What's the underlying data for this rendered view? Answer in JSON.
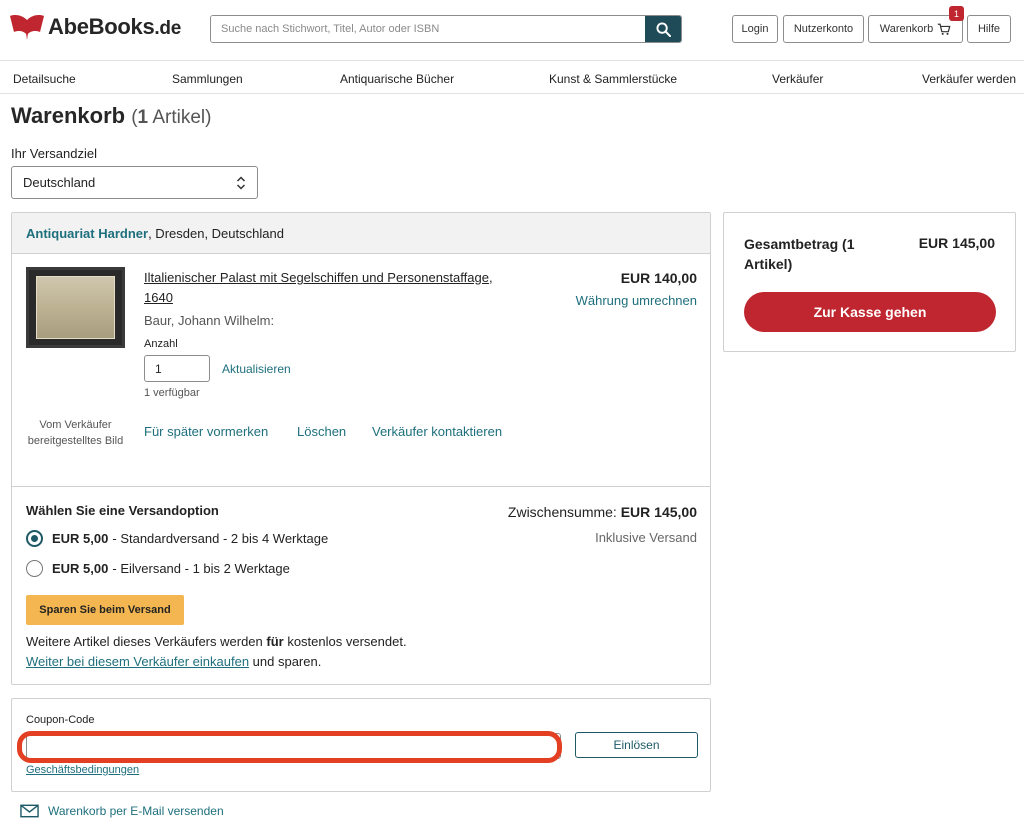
{
  "header": {
    "logo_text": "AbeBooks",
    "logo_tld": ".de",
    "search_placeholder": "Suche nach Stichwort, Titel, Autor oder ISBN",
    "buttons": {
      "login": "Login",
      "account": "Nutzerkonto",
      "cart": "Warenkorb",
      "help": "Hilfe"
    },
    "cart_count": "1"
  },
  "nav": [
    "Detailsuche",
    "Sammlungen",
    "Antiquarische Bücher",
    "Kunst & Sammlerstücke",
    "Verkäufer",
    "Verkäufer werden"
  ],
  "page": {
    "title": "Warenkorb",
    "count_number": "1",
    "count_word": "Artikel",
    "ship_label": "Ihr Versandziel",
    "country": "Deutschland"
  },
  "seller": {
    "name": "Antiquariat Hardner",
    "location": ", Dresden, Deutschland"
  },
  "item": {
    "title": "Iltalienischer Palast mit Segelschiffen und Personenstaffage, 1640",
    "author": "Baur, Johann Wilhelm:",
    "qty_label": "Anzahl",
    "qty": "1",
    "update": "Aktualisieren",
    "available": "1 verfügbar",
    "image_caption": "Vom Verkäufer bereitgestelltes Bild",
    "price": "EUR 140,00",
    "convert": "Währung umrechnen",
    "actions": {
      "save_later": "Für später vormerken",
      "delete": "Löschen",
      "contact": "Verkäufer kontaktieren"
    }
  },
  "shipping": {
    "heading": "Wählen Sie eine Versandoption",
    "subtotal_label": "Zwischensumme:",
    "subtotal_value": "EUR 145,00",
    "incl": "Inklusive Versand",
    "options": [
      {
        "price": "EUR 5,00",
        "desc": "- Standardversand - 2 bis 4 Werktage",
        "selected": true
      },
      {
        "price": "EUR 5,00",
        "desc": "- Eilversand - 1 bis 2 Werktage",
        "selected": false
      }
    ],
    "save_button": "Sparen Sie beim Versand",
    "more_text_1": "Weitere Artikel dieses Verkäufers werden ",
    "more_text_bold": "für",
    "more_text_2": " kostenlos versendet.",
    "more_link": "Weiter bei diesem Verkäufer einkaufen",
    "more_link_suffix": " und sparen."
  },
  "summary": {
    "label": "Gesamtbetrag (1 Artikel)",
    "value": "EUR 145,00",
    "checkout": "Zur Kasse gehen"
  },
  "coupon": {
    "label": "Coupon-Code",
    "value": "",
    "redeem": "Einlösen",
    "terms": "Geschäftsbedingungen"
  },
  "email_cart": "Warenkorb per E-Mail versenden",
  "colors": {
    "brand_red": "#c0262f",
    "teal": "#1e6f7d",
    "dark_teal": "#1e4b57",
    "save_orange": "#f3b651",
    "highlight": "#e33f22"
  }
}
